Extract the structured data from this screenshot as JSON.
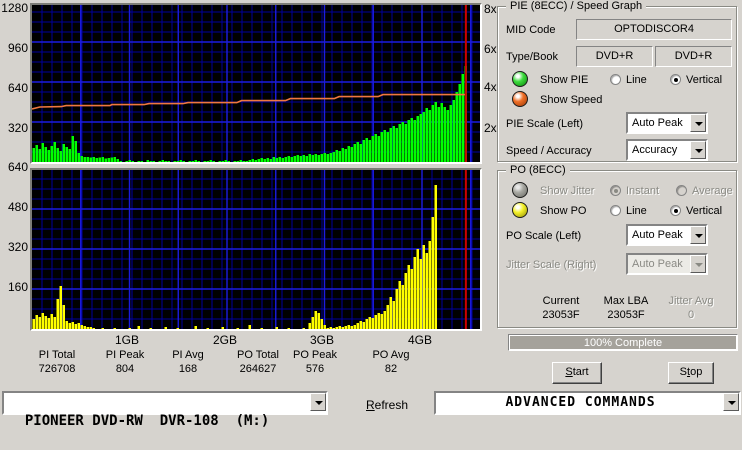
{
  "colors": {
    "window_bg": "#d6d3ce",
    "graph_bg": "#000000",
    "grid_minor": "#00009c",
    "grid_major": "#1c1cdf",
    "pie_bar": "#00ff00",
    "po_bar": "#ffff00",
    "speed_line": "#f07840",
    "cursor_line": "#cc0000",
    "progress_fill": "#a5a29b"
  },
  "axes": {
    "pie_y_ticks": [
      "1280",
      "960",
      "640",
      "320"
    ],
    "speed_ticks": [
      "8x",
      "6x",
      "4x",
      "2x"
    ],
    "po_y_ticks": [
      "640",
      "480",
      "320",
      "160"
    ],
    "x_ticks": [
      "1GB",
      "2GB",
      "3GB",
      "4GB"
    ]
  },
  "chart_data": [
    {
      "type": "bar",
      "title": "PIE (8ECC) / Speed Graph",
      "series": [
        {
          "name": "PIE errors (vertical bars)",
          "color": "#00ff00"
        },
        {
          "name": "Speed (line, right axis)",
          "color": "#f07840"
        }
      ],
      "x_unit": "GB",
      "x_start": 0,
      "x_step_gb": 0.0308,
      "xlim": [
        0,
        4.6
      ],
      "ylim": [
        0,
        1280
      ],
      "y_gridstep": 320,
      "grid": true,
      "values": [
        112,
        136,
        104,
        152,
        120,
        96,
        128,
        160,
        112,
        88,
        144,
        120,
        104,
        208,
        168,
        72,
        48,
        40,
        40,
        36,
        40,
        32,
        36,
        40,
        28,
        32,
        36,
        40,
        24,
        8,
        0,
        8,
        16,
        8,
        0,
        8,
        8,
        0,
        16,
        8,
        8,
        0,
        8,
        16,
        8,
        8,
        0,
        8,
        8,
        16,
        8,
        0,
        8,
        8,
        16,
        8,
        0,
        8,
        8,
        16,
        8,
        0,
        8,
        8,
        16,
        8,
        0,
        8,
        8,
        16,
        8,
        8,
        16,
        24,
        16,
        24,
        32,
        24,
        32,
        24,
        40,
        32,
        40,
        32,
        40,
        48,
        40,
        48,
        56,
        48,
        56,
        48,
        64,
        56,
        64,
        56,
        64,
        72,
        64,
        72,
        80,
        96,
        88,
        112,
        104,
        128,
        120,
        144,
        160,
        144,
        176,
        192,
        176,
        208,
        224,
        208,
        240,
        256,
        240,
        272,
        288,
        272,
        304,
        320,
        304,
        336,
        352,
        336,
        368,
        384,
        400,
        432,
        416,
        456,
        480,
        440,
        472,
        440,
        416,
        456,
        496,
        560,
        624,
        704,
        768
      ],
      "speed_axis": {
        "unit": "x",
        "ticks": [
          8,
          6,
          4,
          2
        ],
        "ylim": [
          0,
          8
        ]
      },
      "speed_points": [
        [
          0,
          3.0
        ],
        [
          0.08,
          3.1
        ],
        [
          0.3,
          3.12
        ],
        [
          0.35,
          3.17
        ],
        [
          0.8,
          3.17
        ],
        [
          0.82,
          3.22
        ],
        [
          1.15,
          3.22
        ],
        [
          1.2,
          3.27
        ],
        [
          1.55,
          3.27
        ],
        [
          1.6,
          3.32
        ],
        [
          2.1,
          3.32
        ],
        [
          2.15,
          3.42
        ],
        [
          2.6,
          3.42
        ],
        [
          2.65,
          3.52
        ],
        [
          3.1,
          3.52
        ],
        [
          3.15,
          3.62
        ],
        [
          3.55,
          3.62
        ],
        [
          3.6,
          3.72
        ],
        [
          4.45,
          3.72
        ]
      ],
      "cursor_gb": 4.45
    },
    {
      "type": "bar",
      "title": "PO (8ECC)",
      "series": [
        {
          "name": "PO errors (vertical bars)",
          "color": "#ffff00"
        }
      ],
      "x_unit": "GB",
      "x_start": 0,
      "x_step_gb": 0.0308,
      "xlim": [
        0,
        4.6
      ],
      "ylim": [
        0,
        640
      ],
      "y_gridstep": 160,
      "grid": true,
      "values": [
        40,
        56,
        48,
        64,
        52,
        44,
        60,
        48,
        120,
        172,
        96,
        32,
        24,
        28,
        20,
        24,
        16,
        12,
        8,
        8,
        4,
        0,
        0,
        4,
        0,
        0,
        0,
        4,
        0,
        0,
        0,
        0,
        4,
        0,
        0,
        12,
        0,
        0,
        0,
        4,
        0,
        0,
        0,
        0,
        8,
        0,
        0,
        0,
        4,
        0,
        0,
        0,
        0,
        0,
        12,
        0,
        0,
        0,
        4,
        0,
        0,
        0,
        0,
        8,
        0,
        0,
        0,
        0,
        4,
        0,
        0,
        0,
        16,
        0,
        0,
        0,
        4,
        0,
        0,
        0,
        0,
        8,
        0,
        0,
        0,
        4,
        0,
        0,
        0,
        0,
        4,
        0,
        24,
        48,
        72,
        64,
        40,
        16,
        4,
        8,
        4,
        8,
        12,
        8,
        12,
        16,
        12,
        16,
        24,
        32,
        28,
        40,
        48,
        44,
        56,
        64,
        60,
        72,
        96,
        128,
        112,
        160,
        192,
        176,
        224,
        256,
        240,
        288,
        320,
        280,
        336,
        304,
        352,
        448,
        576
      ],
      "cursor_gb": 4.45
    }
  ],
  "stats": {
    "items": [
      {
        "label": "PI Total",
        "value": "726708"
      },
      {
        "label": "PI Peak",
        "value": "804"
      },
      {
        "label": "PI Avg",
        "value": "168"
      },
      {
        "label": "PO Total",
        "value": "264627"
      },
      {
        "label": "PO Peak",
        "value": "576"
      },
      {
        "label": "PO Avg",
        "value": "82"
      }
    ]
  },
  "pie_panel": {
    "title": "PIE (8ECC) / Speed Graph",
    "mid_code_label": "MID Code",
    "mid_code_value": "OPTODISCOR4",
    "type_book_label": "Type/Book",
    "type_value": "DVD+R",
    "book_value": "DVD+R",
    "show_pie_label": "Show PIE",
    "show_speed_label": "Show Speed",
    "line_label": "Line",
    "vertical_label": "Vertical",
    "pie_scale_label": "PIE Scale (Left)",
    "pie_scale_value": "Auto Peak",
    "speed_accuracy_label": "Speed / Accuracy",
    "speed_accuracy_value": "Accuracy"
  },
  "po_panel": {
    "title": "PO (8ECC)",
    "show_jitter_label": "Show Jitter",
    "instant_label": "Instant",
    "average_label": "Average",
    "show_po_label": "Show PO",
    "line_label": "Line",
    "vertical_label": "Vertical",
    "po_scale_label": "PO Scale (Left)",
    "po_scale_value": "Auto Peak",
    "jitter_scale_label": "Jitter Scale (Right)",
    "jitter_scale_value": "Auto Peak",
    "current_label": "Current",
    "current_value": "23053F",
    "max_lba_label": "Max LBA",
    "max_lba_value": "23053F",
    "jitter_avg_label": "Jitter Avg",
    "jitter_avg_value": "0"
  },
  "progress": {
    "label": "100% Complete",
    "percent": 100
  },
  "start_button": {
    "pre": "",
    "accel": "S",
    "post": "tart"
  },
  "stop_button": {
    "pre": "S",
    "accel": "t",
    "post": "op"
  },
  "refresh_button": {
    "pre": "",
    "accel": "R",
    "post": "efresh"
  },
  "drive_combo": {
    "value": "PIONEER DVD-RW  DVR-108  (M:)"
  },
  "advanced_combo": {
    "value": "ADVANCED COMMANDS"
  }
}
